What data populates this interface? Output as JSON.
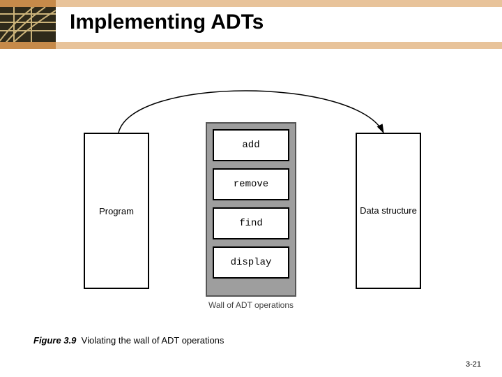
{
  "title": "Implementing ADTs",
  "diagram": {
    "program_label": "Program",
    "data_label": "Data structure",
    "wall_label": "Wall of ADT operations",
    "ops": [
      "add",
      "remove",
      "find",
      "display"
    ]
  },
  "caption": {
    "fig_label": "Figure 3.9",
    "text": "Violating the wall of ADT operations"
  },
  "page_number": "3-21"
}
